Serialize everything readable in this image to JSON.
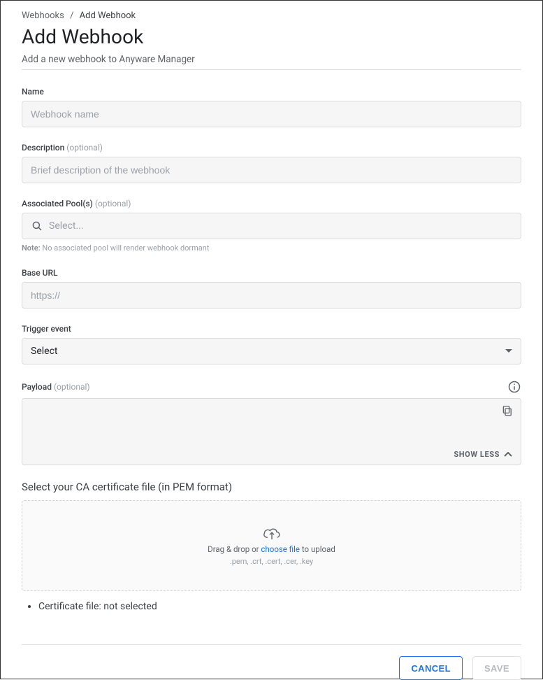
{
  "breadcrumb": {
    "parent": "Webhooks",
    "current": "Add Webhook"
  },
  "page": {
    "title": "Add Webhook",
    "subtitle": "Add a new webhook to Anyware Manager"
  },
  "fields": {
    "name": {
      "label": "Name",
      "placeholder": "Webhook name",
      "value": ""
    },
    "description": {
      "label": "Description",
      "optional": "(optional)",
      "placeholder": "Brief description of the webhook",
      "value": ""
    },
    "pools": {
      "label": "Associated Pool(s)",
      "optional": "(optional)",
      "placeholder": "Select...",
      "note_prefix": "Note:",
      "note_text": "No associated pool will render webhook dormant"
    },
    "baseurl": {
      "label": "Base URL",
      "placeholder": "https://",
      "value": ""
    },
    "trigger": {
      "label": "Trigger event",
      "selected": "Select"
    },
    "payload": {
      "label": "Payload",
      "optional": "(optional)",
      "toggle_text": "SHOW LESS"
    }
  },
  "cert": {
    "heading": "Select your CA certificate file (in PEM format)",
    "drop_prefix": "Drag & drop or ",
    "drop_link": "choose file",
    "drop_suffix": " to upload",
    "extensions": ".pem, .crt, .cert, .cer, .key",
    "status": "Certificate file: not selected"
  },
  "footer": {
    "cancel": "CANCEL",
    "save": "SAVE"
  }
}
